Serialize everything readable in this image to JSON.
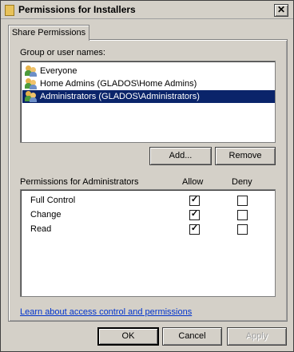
{
  "window": {
    "title": "Permissions for Installers"
  },
  "tabs": [
    {
      "label": "Share Permissions"
    }
  ],
  "users_section": {
    "label": "Group or user names:",
    "items": [
      {
        "label": "Everyone",
        "selected": false
      },
      {
        "label": "Home Admins (GLADOS\\Home Admins)",
        "selected": false
      },
      {
        "label": "Administrators (GLADOS\\Administrators)",
        "selected": true
      }
    ],
    "add_button": "Add...",
    "remove_button": "Remove"
  },
  "permissions_section": {
    "label": "Permissions for Administrators",
    "allow_header": "Allow",
    "deny_header": "Deny",
    "rows": [
      {
        "name": "Full Control",
        "allow": true,
        "deny": false
      },
      {
        "name": "Change",
        "allow": true,
        "deny": false
      },
      {
        "name": "Read",
        "allow": true,
        "deny": false
      }
    ]
  },
  "link": {
    "text": "Learn about access control and permissions"
  },
  "footer": {
    "ok": "OK",
    "cancel": "Cancel",
    "apply": "Apply"
  },
  "icons": {
    "close": "close-icon",
    "folder": "folder-icon",
    "user_group": "user-group-icon"
  },
  "colors": {
    "selection": "#0a246a",
    "link": "#0033cc",
    "face": "#d4d0c8"
  }
}
